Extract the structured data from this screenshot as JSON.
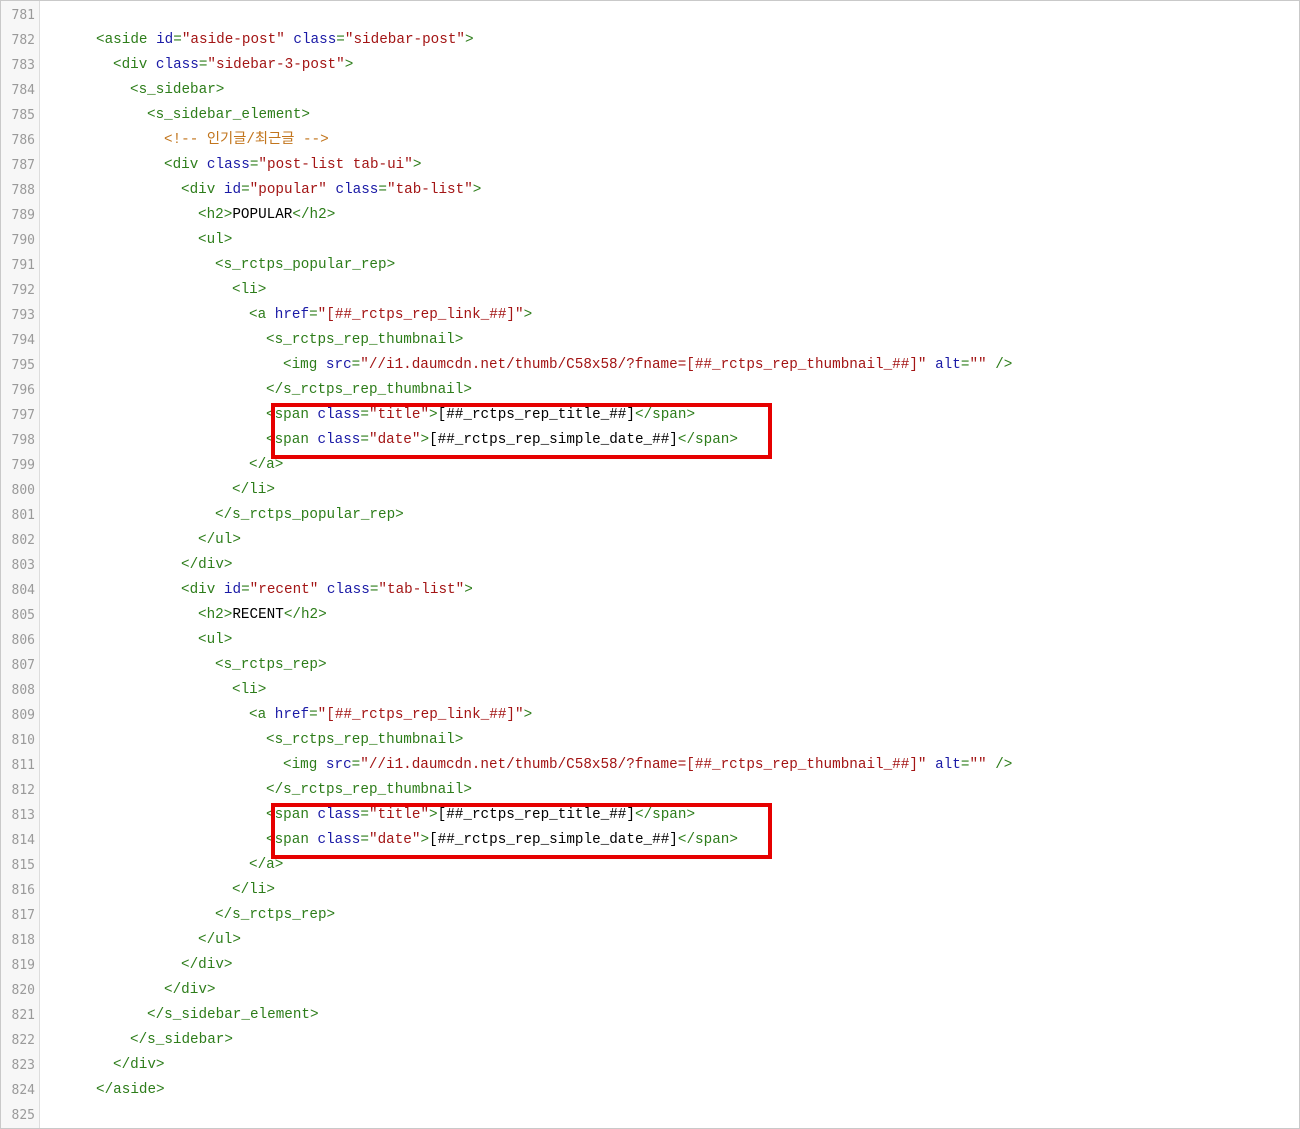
{
  "editor": {
    "colors": {
      "tag": "#2d7d1a",
      "attribute": "#1a1aa6",
      "string": "#a31515",
      "text": "#000000",
      "comment": "#c2751d",
      "line_number": "#9a9a9a",
      "highlight_box": "#e60000"
    },
    "lines": [
      {
        "n": "781",
        "indent": 0,
        "tokens": []
      },
      {
        "n": "782",
        "indent": 2,
        "tokens": [
          {
            "t": "tg",
            "v": "<aside "
          },
          {
            "t": "at",
            "v": "id"
          },
          {
            "t": "tg",
            "v": "="
          },
          {
            "t": "st",
            "v": "\"aside-post\""
          },
          {
            "t": "tg",
            "v": " "
          },
          {
            "t": "at",
            "v": "class"
          },
          {
            "t": "tg",
            "v": "="
          },
          {
            "t": "st",
            "v": "\"sidebar-post\""
          },
          {
            "t": "tg",
            "v": ">"
          }
        ]
      },
      {
        "n": "783",
        "indent": 3,
        "tokens": [
          {
            "t": "tg",
            "v": "<div "
          },
          {
            "t": "at",
            "v": "class"
          },
          {
            "t": "tg",
            "v": "="
          },
          {
            "t": "st",
            "v": "\"sidebar-3-post\""
          },
          {
            "t": "tg",
            "v": ">"
          }
        ]
      },
      {
        "n": "784",
        "indent": 4,
        "tokens": [
          {
            "t": "tg",
            "v": "<s_sidebar>"
          }
        ]
      },
      {
        "n": "785",
        "indent": 5,
        "tokens": [
          {
            "t": "tg",
            "v": "<s_sidebar_element>"
          }
        ]
      },
      {
        "n": "786",
        "indent": 6,
        "tokens": [
          {
            "t": "cm",
            "v": "<!-- 인기글/최근글 -->"
          }
        ]
      },
      {
        "n": "787",
        "indent": 6,
        "tokens": [
          {
            "t": "tg",
            "v": "<div "
          },
          {
            "t": "at",
            "v": "class"
          },
          {
            "t": "tg",
            "v": "="
          },
          {
            "t": "st",
            "v": "\"post-list tab-ui\""
          },
          {
            "t": "tg",
            "v": ">"
          }
        ]
      },
      {
        "n": "788",
        "indent": 7,
        "tokens": [
          {
            "t": "tg",
            "v": "<div "
          },
          {
            "t": "at",
            "v": "id"
          },
          {
            "t": "tg",
            "v": "="
          },
          {
            "t": "st",
            "v": "\"popular\""
          },
          {
            "t": "tg",
            "v": " "
          },
          {
            "t": "at",
            "v": "class"
          },
          {
            "t": "tg",
            "v": "="
          },
          {
            "t": "st",
            "v": "\"tab-list\""
          },
          {
            "t": "tg",
            "v": ">"
          }
        ]
      },
      {
        "n": "789",
        "indent": 8,
        "tokens": [
          {
            "t": "tg",
            "v": "<h2>"
          },
          {
            "t": "tx",
            "v": "POPULAR"
          },
          {
            "t": "tg",
            "v": "</h2>"
          }
        ]
      },
      {
        "n": "790",
        "indent": 8,
        "tokens": [
          {
            "t": "tg",
            "v": "<ul>"
          }
        ]
      },
      {
        "n": "791",
        "indent": 9,
        "tokens": [
          {
            "t": "tg",
            "v": "<s_rctps_popular_rep>"
          }
        ]
      },
      {
        "n": "792",
        "indent": 10,
        "tokens": [
          {
            "t": "tg",
            "v": "<li>"
          }
        ]
      },
      {
        "n": "793",
        "indent": 11,
        "tokens": [
          {
            "t": "tg",
            "v": "<a "
          },
          {
            "t": "at",
            "v": "href"
          },
          {
            "t": "tg",
            "v": "="
          },
          {
            "t": "st",
            "v": "\"[##_rctps_rep_link_##]\""
          },
          {
            "t": "tg",
            "v": ">"
          }
        ]
      },
      {
        "n": "794",
        "indent": 12,
        "tokens": [
          {
            "t": "tg",
            "v": "<s_rctps_rep_thumbnail>"
          }
        ]
      },
      {
        "n": "795",
        "indent": 13,
        "tokens": [
          {
            "t": "tg",
            "v": "<img "
          },
          {
            "t": "at",
            "v": "src"
          },
          {
            "t": "tg",
            "v": "="
          },
          {
            "t": "st",
            "v": "\"//i1.daumcdn.net/thumb/C58x58/?fname=[##_rctps_rep_thumbnail_##]\""
          },
          {
            "t": "tg",
            "v": " "
          },
          {
            "t": "at",
            "v": "alt"
          },
          {
            "t": "tg",
            "v": "="
          },
          {
            "t": "st",
            "v": "\"\""
          },
          {
            "t": "tg",
            "v": " />"
          }
        ]
      },
      {
        "n": "796",
        "indent": 12,
        "tokens": [
          {
            "t": "tg",
            "v": "</s_rctps_rep_thumbnail>"
          }
        ]
      },
      {
        "n": "797",
        "indent": 12,
        "tokens": [
          {
            "t": "tg",
            "v": "<span "
          },
          {
            "t": "at",
            "v": "class"
          },
          {
            "t": "tg",
            "v": "="
          },
          {
            "t": "st",
            "v": "\"title\""
          },
          {
            "t": "tg",
            "v": ">"
          },
          {
            "t": "tx",
            "v": "[##_rctps_rep_title_##]"
          },
          {
            "t": "tg",
            "v": "</span>"
          }
        ]
      },
      {
        "n": "798",
        "indent": 12,
        "tokens": [
          {
            "t": "tg",
            "v": "<span "
          },
          {
            "t": "at",
            "v": "class"
          },
          {
            "t": "tg",
            "v": "="
          },
          {
            "t": "st",
            "v": "\"date\""
          },
          {
            "t": "tg",
            "v": ">"
          },
          {
            "t": "tx",
            "v": "[##_rctps_rep_simple_date_##]"
          },
          {
            "t": "tg",
            "v": "</span>"
          }
        ]
      },
      {
        "n": "799",
        "indent": 11,
        "tokens": [
          {
            "t": "tg",
            "v": "</a>"
          }
        ]
      },
      {
        "n": "800",
        "indent": 10,
        "tokens": [
          {
            "t": "tg",
            "v": "</li>"
          }
        ]
      },
      {
        "n": "801",
        "indent": 9,
        "tokens": [
          {
            "t": "tg",
            "v": "</s_rctps_popular_rep>"
          }
        ]
      },
      {
        "n": "802",
        "indent": 8,
        "tokens": [
          {
            "t": "tg",
            "v": "</ul>"
          }
        ]
      },
      {
        "n": "803",
        "indent": 7,
        "tokens": [
          {
            "t": "tg",
            "v": "</div>"
          }
        ]
      },
      {
        "n": "804",
        "indent": 7,
        "tokens": [
          {
            "t": "tg",
            "v": "<div "
          },
          {
            "t": "at",
            "v": "id"
          },
          {
            "t": "tg",
            "v": "="
          },
          {
            "t": "st",
            "v": "\"recent\""
          },
          {
            "t": "tg",
            "v": " "
          },
          {
            "t": "at",
            "v": "class"
          },
          {
            "t": "tg",
            "v": "="
          },
          {
            "t": "st",
            "v": "\"tab-list\""
          },
          {
            "t": "tg",
            "v": ">"
          }
        ]
      },
      {
        "n": "805",
        "indent": 8,
        "tokens": [
          {
            "t": "tg",
            "v": "<h2>"
          },
          {
            "t": "tx",
            "v": "RECENT"
          },
          {
            "t": "tg",
            "v": "</h2>"
          }
        ]
      },
      {
        "n": "806",
        "indent": 8,
        "tokens": [
          {
            "t": "tg",
            "v": "<ul>"
          }
        ]
      },
      {
        "n": "807",
        "indent": 9,
        "tokens": [
          {
            "t": "tg",
            "v": "<s_rctps_rep>"
          }
        ]
      },
      {
        "n": "808",
        "indent": 10,
        "tokens": [
          {
            "t": "tg",
            "v": "<li>"
          }
        ]
      },
      {
        "n": "809",
        "indent": 11,
        "tokens": [
          {
            "t": "tg",
            "v": "<a "
          },
          {
            "t": "at",
            "v": "href"
          },
          {
            "t": "tg",
            "v": "="
          },
          {
            "t": "st",
            "v": "\"[##_rctps_rep_link_##]\""
          },
          {
            "t": "tg",
            "v": ">"
          }
        ]
      },
      {
        "n": "810",
        "indent": 12,
        "tokens": [
          {
            "t": "tg",
            "v": "<s_rctps_rep_thumbnail>"
          }
        ]
      },
      {
        "n": "811",
        "indent": 13,
        "tokens": [
          {
            "t": "tg",
            "v": "<img "
          },
          {
            "t": "at",
            "v": "src"
          },
          {
            "t": "tg",
            "v": "="
          },
          {
            "t": "st",
            "v": "\"//i1.daumcdn.net/thumb/C58x58/?fname=[##_rctps_rep_thumbnail_##]\""
          },
          {
            "t": "tg",
            "v": " "
          },
          {
            "t": "at",
            "v": "alt"
          },
          {
            "t": "tg",
            "v": "="
          },
          {
            "t": "st",
            "v": "\"\""
          },
          {
            "t": "tg",
            "v": " />"
          }
        ]
      },
      {
        "n": "812",
        "indent": 12,
        "tokens": [
          {
            "t": "tg",
            "v": "</s_rctps_rep_thumbnail>"
          }
        ]
      },
      {
        "n": "813",
        "indent": 12,
        "tokens": [
          {
            "t": "tg",
            "v": "<span "
          },
          {
            "t": "at",
            "v": "class"
          },
          {
            "t": "tg",
            "v": "="
          },
          {
            "t": "st",
            "v": "\"title\""
          },
          {
            "t": "tg",
            "v": ">"
          },
          {
            "t": "tx",
            "v": "[##_rctps_rep_title_##]"
          },
          {
            "t": "tg",
            "v": "</span>"
          }
        ]
      },
      {
        "n": "814",
        "indent": 12,
        "tokens": [
          {
            "t": "tg",
            "v": "<span "
          },
          {
            "t": "at",
            "v": "class"
          },
          {
            "t": "tg",
            "v": "="
          },
          {
            "t": "st",
            "v": "\"date\""
          },
          {
            "t": "tg",
            "v": ">"
          },
          {
            "t": "tx",
            "v": "[##_rctps_rep_simple_date_##]"
          },
          {
            "t": "tg",
            "v": "</span>"
          }
        ]
      },
      {
        "n": "815",
        "indent": 11,
        "tokens": [
          {
            "t": "tg",
            "v": "</a>"
          }
        ]
      },
      {
        "n": "816",
        "indent": 10,
        "tokens": [
          {
            "t": "tg",
            "v": "</li>"
          }
        ]
      },
      {
        "n": "817",
        "indent": 9,
        "tokens": [
          {
            "t": "tg",
            "v": "</s_rctps_rep>"
          }
        ]
      },
      {
        "n": "818",
        "indent": 8,
        "tokens": [
          {
            "t": "tg",
            "v": "</ul>"
          }
        ]
      },
      {
        "n": "819",
        "indent": 7,
        "tokens": [
          {
            "t": "tg",
            "v": "</div>"
          }
        ]
      },
      {
        "n": "820",
        "indent": 6,
        "tokens": [
          {
            "t": "tg",
            "v": "</div>"
          }
        ]
      },
      {
        "n": "821",
        "indent": 5,
        "tokens": [
          {
            "t": "tg",
            "v": "</s_sidebar_element>"
          }
        ]
      },
      {
        "n": "822",
        "indent": 4,
        "tokens": [
          {
            "t": "tg",
            "v": "</s_sidebar>"
          }
        ]
      },
      {
        "n": "823",
        "indent": 3,
        "tokens": [
          {
            "t": "tg",
            "v": "</div>"
          }
        ]
      },
      {
        "n": "824",
        "indent": 2,
        "tokens": [
          {
            "t": "tg",
            "v": "</aside>"
          }
        ]
      },
      {
        "n": "825",
        "indent": 0,
        "tokens": []
      }
    ],
    "highlights": [
      {
        "from_line": "797",
        "to_line": "798"
      },
      {
        "from_line": "813",
        "to_line": "814"
      }
    ]
  }
}
